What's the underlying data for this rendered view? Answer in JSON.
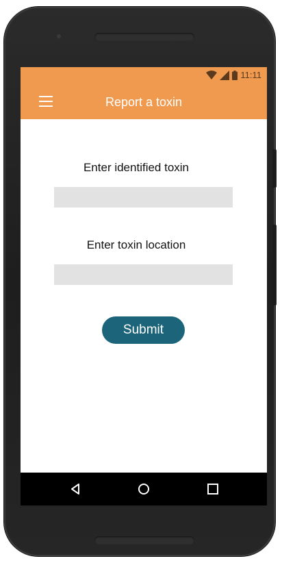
{
  "status_bar": {
    "time": "11:11",
    "icons": [
      "wifi-icon",
      "signal-icon",
      "battery-icon"
    ]
  },
  "app_bar": {
    "title": "Report a toxin",
    "menu_icon": "hamburger-menu-icon"
  },
  "form": {
    "toxin_label": "Enter identified toxin",
    "toxin_value": "",
    "location_label": "Enter toxin location",
    "location_value": "",
    "submit_label": "Submit"
  },
  "nav_bar": {
    "icons": [
      "back-icon",
      "home-icon",
      "recent-apps-icon"
    ]
  },
  "colors": {
    "app_bar": "#ef9a4f",
    "submit_button": "#1b6479",
    "input_background": "#e2e2e2",
    "nav_bar": "#000000"
  }
}
